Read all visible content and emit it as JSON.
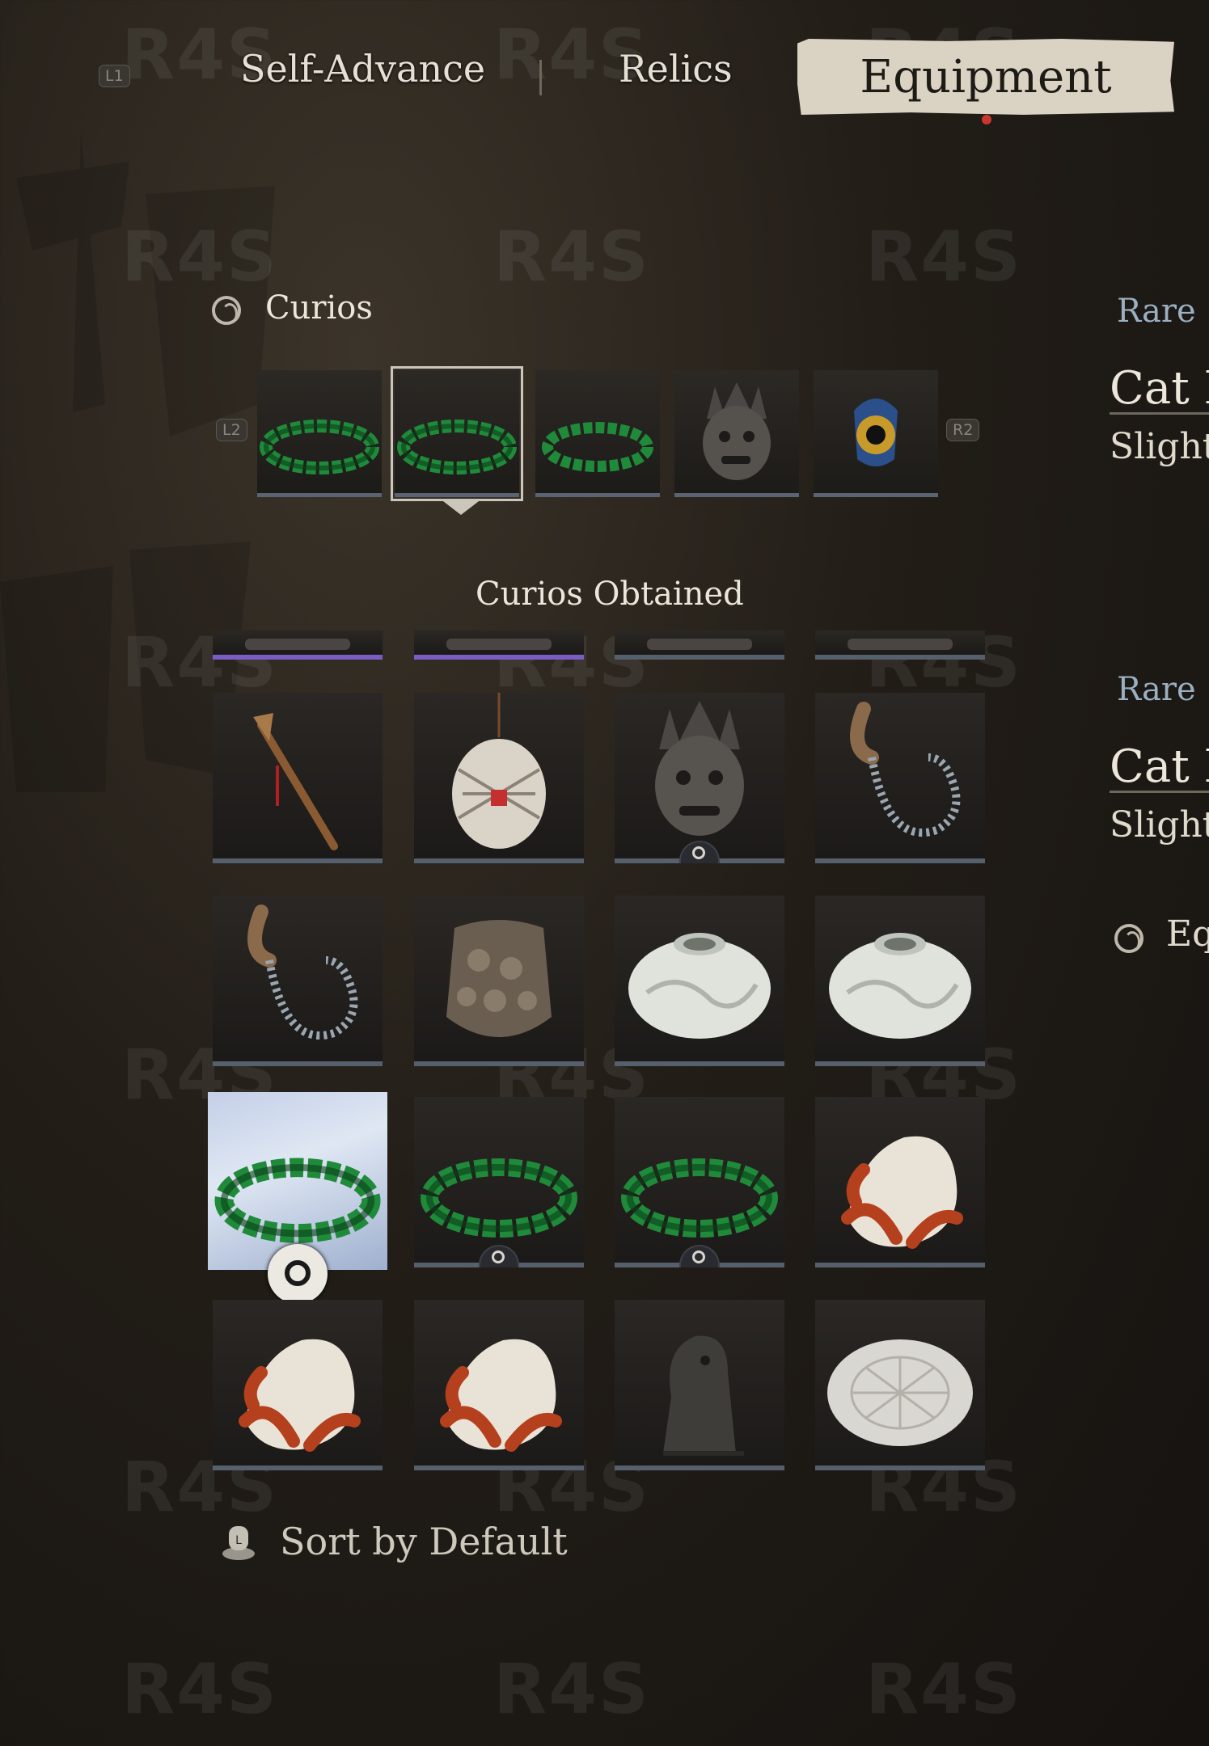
{
  "tabs": {
    "hint_left": "L1",
    "items": [
      "Self-Advance",
      "Relics",
      "Equipment"
    ],
    "active": "Equipment"
  },
  "curios": {
    "title": "Curios",
    "hint_prev": "L2",
    "hint_next": "R2",
    "equipped_slots": [
      "prayer-beads",
      "prayer-beads",
      "prayer-beads",
      "demon-mask",
      "cat-eye-bead"
    ],
    "selected_slot": 2
  },
  "obtained": {
    "title": "Curios Obtained",
    "items": [
      {
        "icon": "unknown-partial",
        "rarity": "purple"
      },
      {
        "icon": "unknown-partial",
        "rarity": "purple"
      },
      {
        "icon": "unknown-partial",
        "rarity": "default"
      },
      {
        "icon": "unknown-partial",
        "rarity": "default"
      },
      {
        "icon": "back-scratcher",
        "rarity": "default"
      },
      {
        "icon": "woven-lantern",
        "rarity": "default"
      },
      {
        "icon": "demon-mask",
        "rarity": "default",
        "equipped": true
      },
      {
        "icon": "centipede-hook",
        "rarity": "default"
      },
      {
        "icon": "centipede-hook",
        "rarity": "default"
      },
      {
        "icon": "shell-necklace",
        "rarity": "default"
      },
      {
        "icon": "porcelain-jar",
        "rarity": "default"
      },
      {
        "icon": "porcelain-jar",
        "rarity": "default"
      },
      {
        "icon": "prayer-beads",
        "rarity": "default",
        "selected": true,
        "equipped": true
      },
      {
        "icon": "prayer-beads",
        "rarity": "default",
        "equipped": true
      },
      {
        "icon": "prayer-beads",
        "rarity": "default",
        "equipped": true
      },
      {
        "icon": "coral-carving",
        "rarity": "default"
      },
      {
        "icon": "coral-carving",
        "rarity": "default"
      },
      {
        "icon": "coral-carving",
        "rarity": "default"
      },
      {
        "icon": "bronze-beast",
        "rarity": "default"
      },
      {
        "icon": "carved-stone-disc",
        "rarity": "default"
      }
    ]
  },
  "detail": {
    "top": {
      "rarity": "Rare",
      "name": "Cat E",
      "desc": "Slightl"
    },
    "bottom": {
      "rarity": "Rare",
      "name": "Cat E",
      "desc": "Slightl",
      "equip_label": "Eq"
    }
  },
  "footer": {
    "sort_hint": "L",
    "sort_label": "Sort by Default"
  },
  "watermark": "R4S",
  "colors": {
    "rare": "#9ab0c2",
    "purple_rarity": "#7b5cc2",
    "default_rarity": "#56606c",
    "active_tab_bg": "#dad3c4",
    "active_dot": "#c8372d"
  }
}
